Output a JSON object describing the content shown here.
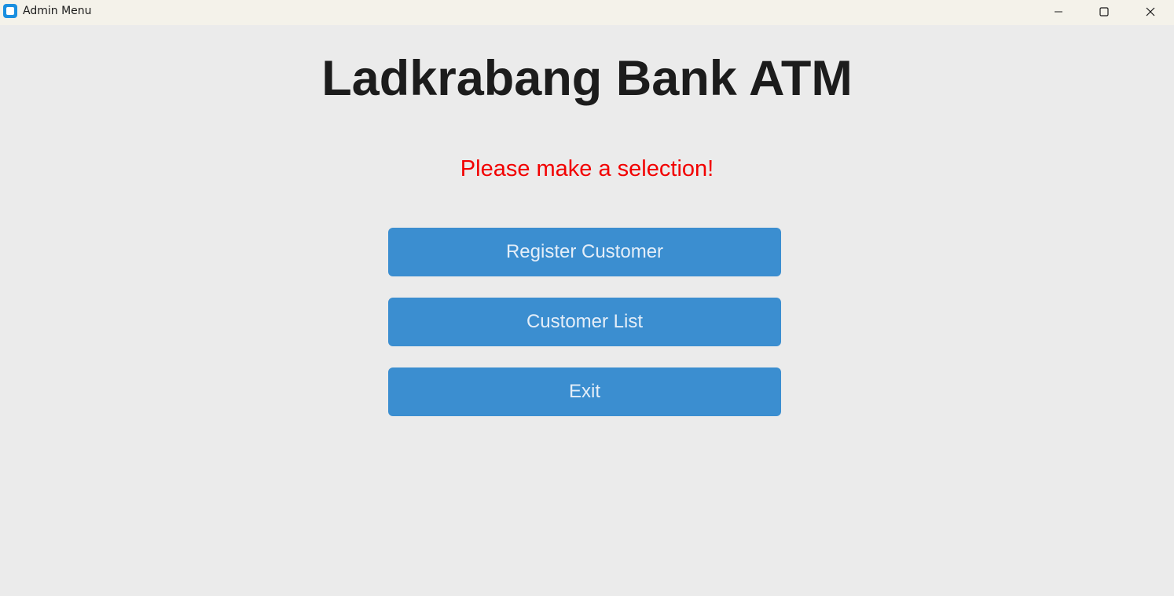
{
  "window": {
    "title": "Admin Menu",
    "controls": {
      "minimize_icon": "minimize-icon",
      "maximize_icon": "maximize-icon",
      "close_icon": "close-icon"
    }
  },
  "main": {
    "heading": "Ladkrabang Bank ATM",
    "prompt": "Please make a selection!",
    "buttons": [
      {
        "label": "Register Customer"
      },
      {
        "label": "Customer List"
      },
      {
        "label": "Exit"
      }
    ]
  },
  "colors": {
    "background": "#ebebeb",
    "titlebar": "#f4f2ea",
    "button": "#3b8ed0",
    "button_text": "#e4eef8",
    "prompt": "#f20000",
    "heading": "#1c1c1c"
  }
}
